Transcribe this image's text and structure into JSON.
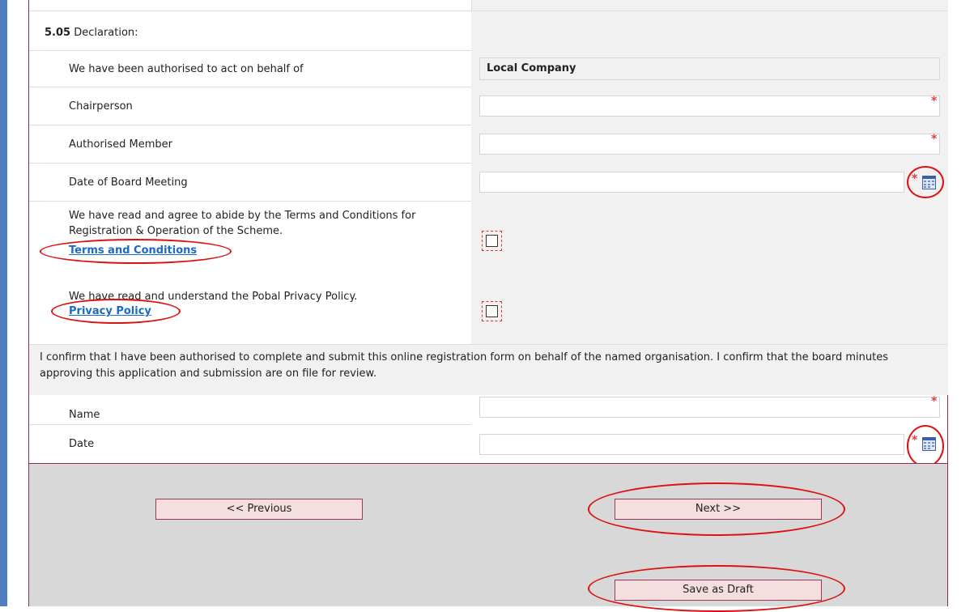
{
  "section": {
    "number": "5.05",
    "title": "Declaration:"
  },
  "fields": {
    "behalf_label": "We have been authorised to act on behalf of",
    "behalf_value": "Local Company",
    "chairperson_label": "Chairperson",
    "authorised_member_label": "Authorised Member",
    "board_meeting_label": "Date of Board Meeting",
    "name_label": "Name",
    "date_label": "Date",
    "required_marker": "*"
  },
  "terms": {
    "text": "We have read and agree to abide by the Terms and Conditions for Registration & Operation of the Scheme.",
    "link": "Terms and Conditions"
  },
  "privacy": {
    "text": "We have read and understand the Pobal Privacy Policy.",
    "link": "Privacy Policy"
  },
  "confirm_text": "I confirm that I have been authorised to complete and submit this online registration form on behalf of the named organisation. I confirm that the board minutes approving this application and submission are on file for review.",
  "buttons": {
    "previous": "<< Previous",
    "next": "Next >>",
    "save_draft": "Save as Draft"
  },
  "colors": {
    "highlight": "#dd1111",
    "link": "#1a6bc5",
    "required": "#e23b3b",
    "button_bg": "#f5dede",
    "frame_border": "#8e2a5a"
  }
}
